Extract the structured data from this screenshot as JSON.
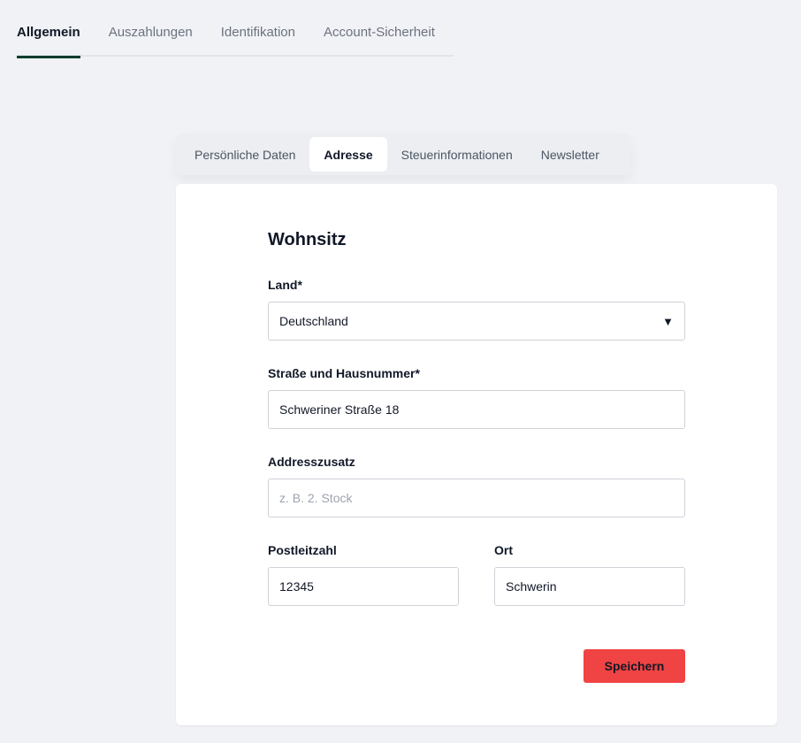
{
  "top_tabs": [
    {
      "label": "Allgemein",
      "active": true
    },
    {
      "label": "Auszahlungen",
      "active": false
    },
    {
      "label": "Identifikation",
      "active": false
    },
    {
      "label": "Account-Sicherheit",
      "active": false
    }
  ],
  "sub_tabs": [
    {
      "label": "Persönliche Daten",
      "active": false
    },
    {
      "label": "Adresse",
      "active": true
    },
    {
      "label": "Steuerinformationen",
      "active": false
    },
    {
      "label": "Newsletter",
      "active": false
    }
  ],
  "form": {
    "title": "Wohnsitz",
    "country": {
      "label": "Land*",
      "value": "Deutschland",
      "icon": "caret-down-icon"
    },
    "street": {
      "label": "Straße und Hausnummer*",
      "value": "Schweriner Straße 18"
    },
    "address_extra": {
      "label": "Addresszusatz",
      "value": "",
      "placeholder": "z. B. 2. Stock"
    },
    "postal_code": {
      "label": "Postleitzahl",
      "value": "12345"
    },
    "city": {
      "label": "Ort",
      "value": "Schwerin"
    },
    "save_label": "Speichern"
  },
  "colors": {
    "accent_underline": "#0f3d2e",
    "save_button": "#f04343",
    "page_background": "#f1f2f6"
  }
}
